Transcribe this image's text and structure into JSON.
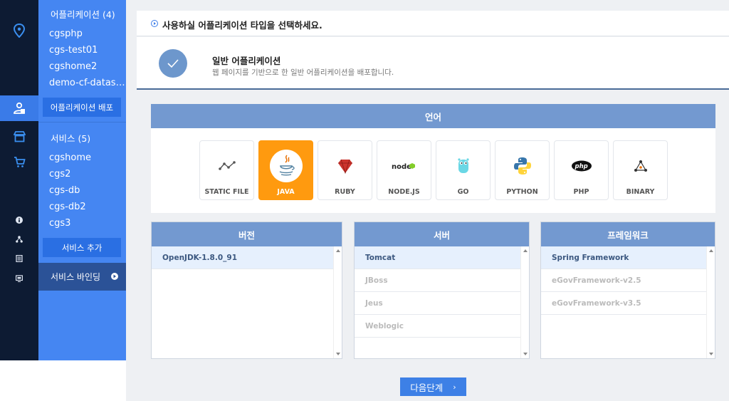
{
  "rail": {
    "icons": [
      "location-pin-icon",
      "app-deploy-icon",
      "store-icon",
      "cart-icon",
      "info-icon",
      "user-tree-icon",
      "document-icon",
      "monitor-icon"
    ]
  },
  "sidebar": {
    "apps_header": "어플리케이션 (4)",
    "apps": [
      "cgsphp",
      "cgs-test01",
      "cgshome2",
      "demo-cf-dataso..."
    ],
    "deploy_button": "어플리케이션 배포",
    "services_header": "서비스 (5)",
    "services": [
      "cgshome",
      "cgs2",
      "cgs-db",
      "cgs-db2",
      "cgs3"
    ],
    "add_service_button": "서비스 추가",
    "binding_label": "서비스 바인딩"
  },
  "header": {
    "title": "사용하실 어플리케이션 타입을 선택하세요."
  },
  "app_type": {
    "name": "일반 어플리케이션",
    "description": "웹 페이지를 기반으로 한 일반 어플리케이션을 배포합니다."
  },
  "language": {
    "header": "언어",
    "selected": "JAVA",
    "options": [
      "STATIC FILE",
      "JAVA",
      "RUBY",
      "NODE.JS",
      "GO",
      "PYTHON",
      "PHP",
      "BINARY"
    ]
  },
  "version": {
    "header": "버전",
    "items": [
      "OpenJDK-1.8.0_91"
    ],
    "selected": "OpenJDK-1.8.0_91"
  },
  "server": {
    "header": "서버",
    "items": [
      "Tomcat",
      "JBoss",
      "Jeus",
      "Weblogic"
    ],
    "selected": "Tomcat"
  },
  "framework": {
    "header": "프레임워크",
    "items": [
      "Spring Framework",
      "eGovFramework-v2.5",
      "eGovFramework-v3.5"
    ],
    "selected": "Spring Framework"
  },
  "next_button": "다음단계",
  "colors": {
    "rail": "#0d1b33",
    "sidebar": "#4586f2",
    "panel_header": "#7399d0",
    "selected_tile": "#ff9a0f",
    "primary": "#3d80e6"
  }
}
